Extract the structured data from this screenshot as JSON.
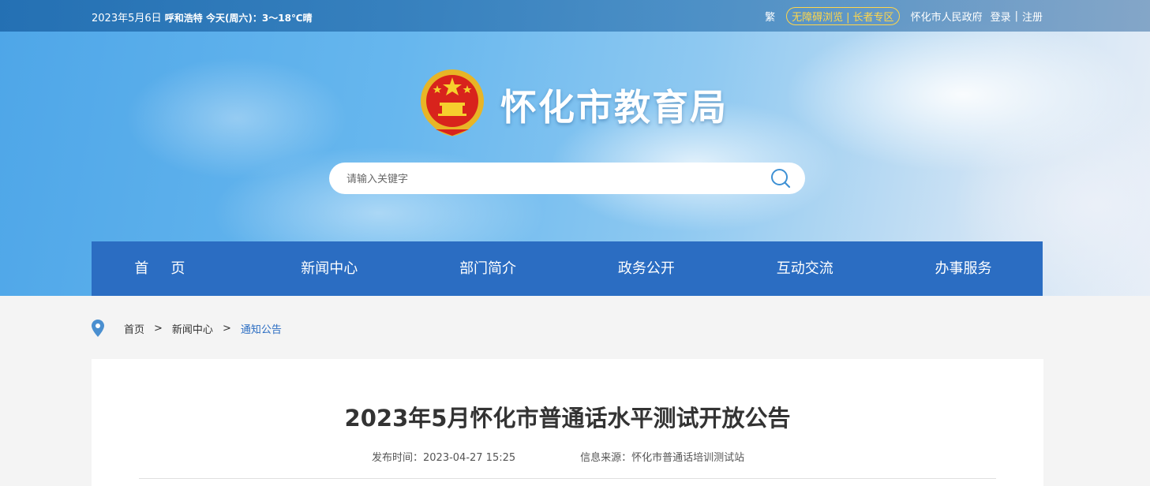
{
  "topbar": {
    "date": "2023年5月6日",
    "city": "呼和浩特",
    "weather": "今天(周六)：3～18℃晴",
    "traditional": "繁",
    "accessible": "无障碍浏览",
    "elderly": "长者专区",
    "gov_link": "怀化市人民政府",
    "login": "登录",
    "register": "注册"
  },
  "header": {
    "site_title": "怀化市教育局",
    "emblem_icon": "national-emblem-icon"
  },
  "search": {
    "placeholder": "请输入关键字",
    "icon": "search-icon"
  },
  "nav": {
    "items": [
      "首页",
      "新闻中心",
      "部门简介",
      "政务公开",
      "互动交流",
      "办事服务"
    ]
  },
  "breadcrumb": {
    "icon": "location-pin-icon",
    "items": [
      "首页",
      "新闻中心",
      "通知公告"
    ],
    "separator": ">"
  },
  "article": {
    "title": "2023年5月怀化市普通话水平测试开放公告",
    "publish_time": "发布时间：2023-04-27 15:25",
    "source": "信息来源：怀化市普通话培训测试站"
  },
  "colors": {
    "nav_bg": "#2b6dc2",
    "accent_yellow": "#ffd64a",
    "breadcrumb_current": "#2b6dc2"
  }
}
